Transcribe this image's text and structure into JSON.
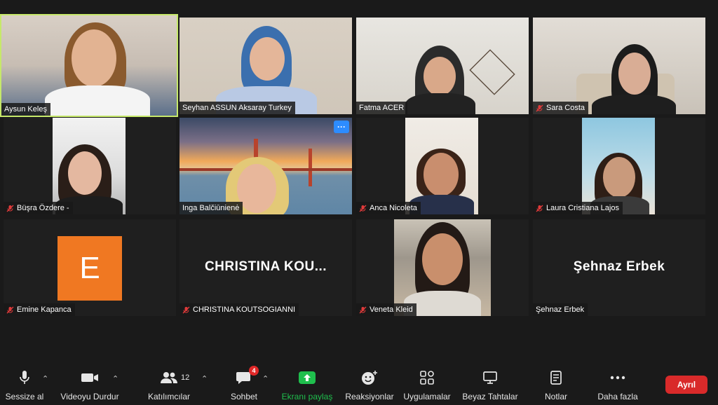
{
  "participants": [
    {
      "name": "Aysun Keleş",
      "muted": false,
      "active_speaker": true
    },
    {
      "name": "Seyhan ASSUN Aksaray Turkey",
      "muted": false
    },
    {
      "name": "Fatma ACER",
      "muted": false
    },
    {
      "name": "Sara Costa",
      "muted": true
    },
    {
      "name": "Büşra Özdere -",
      "muted": true
    },
    {
      "name": "Inga Balčiūnienė",
      "muted": false
    },
    {
      "name": "Anca Nicoleta",
      "muted": true
    },
    {
      "name": "Laura Cristiana Lajos",
      "muted": true
    },
    {
      "name": "Emine Kapanca",
      "muted": true,
      "avatar_letter": "E",
      "avatar_color": "#f07822"
    },
    {
      "name": "CHRISTINA KOUTSOGIANNI",
      "muted": true,
      "display_text": "CHRISTINA  KOU..."
    },
    {
      "name": "Veneta Kleid",
      "muted": true
    },
    {
      "name": "Şehnaz Erbek",
      "muted": false,
      "display_text": "Şehnaz Erbek"
    }
  ],
  "tile_more_icon": "more-horizontal-icon",
  "toolbar": {
    "mute_label": "Sessize al",
    "video_label": "Videoyu Durdur",
    "participants_label": "Katılımcılar",
    "participants_count": "12",
    "chat_label": "Sohbet",
    "chat_badge": "4",
    "share_label": "Ekranı paylaş",
    "reactions_label": "Reaksiyonlar",
    "apps_label": "Uygulamalar",
    "whiteboard_label": "Beyaz Tahtalar",
    "notes_label": "Notlar",
    "more_label": "Daha fazla",
    "leave_label": "Ayrıl"
  },
  "colors": {
    "background": "#1a1a1a",
    "tile": "#1f1f1f",
    "active_speaker_border": "#c6e86a",
    "share_green": "#1fbf4d",
    "leave_red": "#d92a2a",
    "badge_red": "#e02828",
    "more_blue": "#2d8cff"
  }
}
